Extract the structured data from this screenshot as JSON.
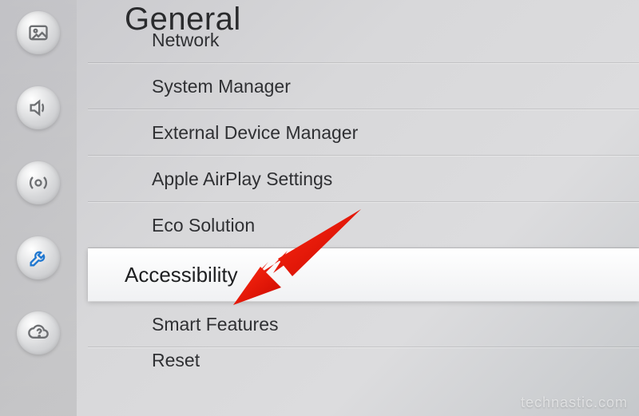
{
  "page": {
    "title": "General"
  },
  "items": {
    "network": "Network",
    "system_manager": "System Manager",
    "external_device_manager": "External Device Manager",
    "airplay": "Apple AirPlay Settings",
    "eco": "Eco Solution",
    "accessibility": "Accessibility",
    "smart_features": "Smart Features",
    "reset": "Reset"
  },
  "watermark": "technastic.com"
}
